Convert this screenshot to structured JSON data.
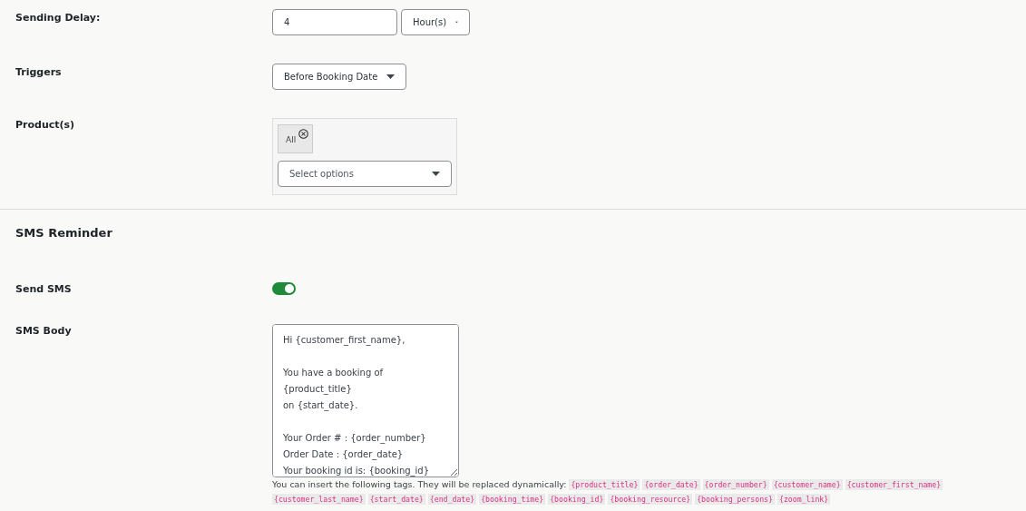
{
  "sending_delay": {
    "label": "Sending Delay:",
    "value": "4",
    "unit": "Hour(s)"
  },
  "triggers": {
    "label": "Triggers",
    "value": "Before Booking Date"
  },
  "products": {
    "label": "Product(s)",
    "chips": [
      "All"
    ],
    "placeholder": "Select options"
  },
  "sms_reminder": {
    "heading": "SMS Reminder",
    "send_sms": {
      "label": "Send SMS",
      "on": true
    },
    "sms_body": {
      "label": "SMS Body",
      "value": "Hi {customer_first_name},\n\nYou have a booking of {product_title}\non {start_date}.\n\nYour Order # : {order_number}\nOrder Date : {order_date}\nYour booking id is: {booking_id}"
    },
    "hint": "You can insert the following tags. They will be replaced dynamically:",
    "tags": [
      "{product_title}",
      "{order_date}",
      "{order_number}",
      "{customer_name}",
      "{customer_first_name}",
      "{customer_last_name}",
      "{start_date}",
      "{end_date}",
      "{booking_time}",
      "{booking_id}",
      "{booking_resource}",
      "{booking_persons}",
      "{zoom_link}"
    ]
  }
}
